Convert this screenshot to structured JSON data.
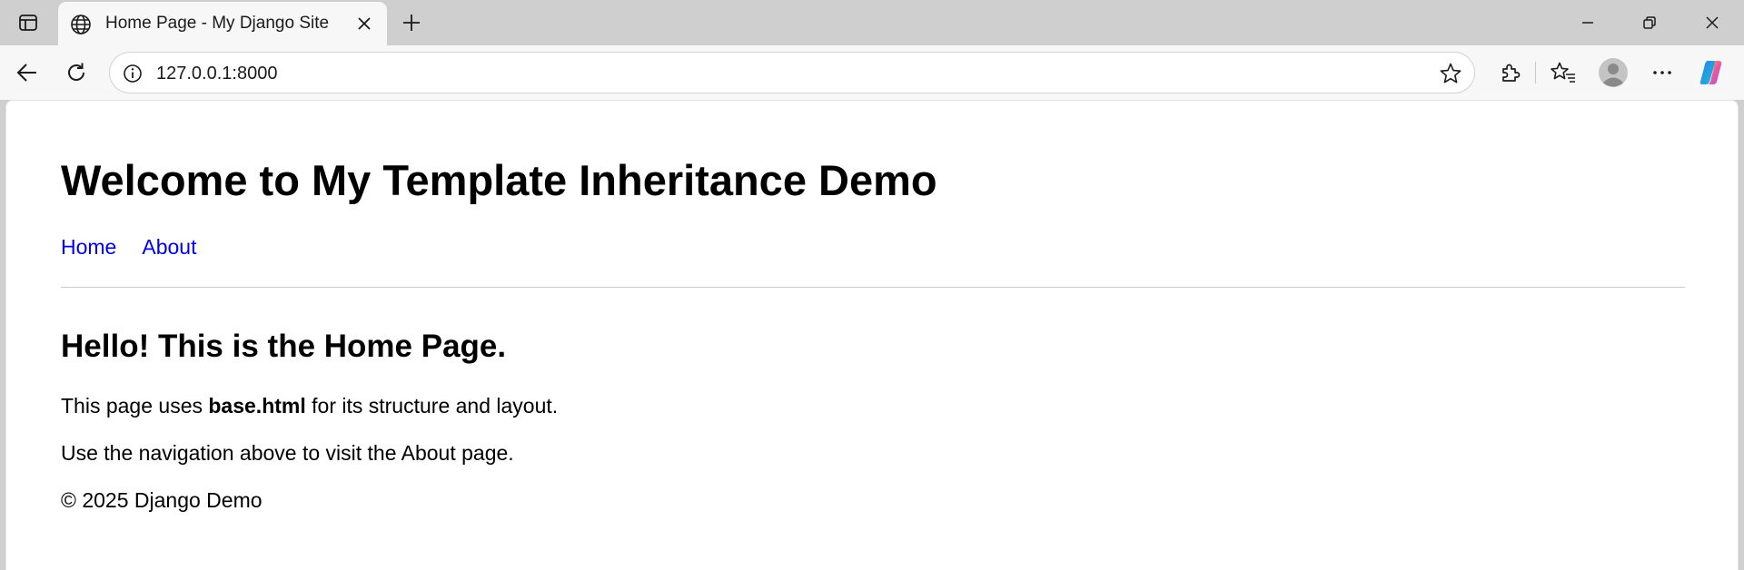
{
  "browser": {
    "tab": {
      "title": "Home Page - My Django Site"
    },
    "address_bar": {
      "url": "127.0.0.1:8000"
    },
    "icons": {
      "tab_actions": "tab-actions-icon",
      "favicon": "globe-icon",
      "tab_close": "close-icon",
      "new_tab": "plus-icon",
      "minimize": "minimize-icon",
      "restore": "restore-icon",
      "window_close": "close-icon",
      "back": "back-arrow-icon",
      "reload": "reload-icon",
      "site_info": "info-icon",
      "favorite": "star-icon",
      "extensions": "puzzle-icon",
      "favorites": "favorites-icon",
      "profile": "avatar-icon",
      "more": "more-icon",
      "copilot": "copilot-icon"
    }
  },
  "page": {
    "site_title": "Welcome to My Template Inheritance Demo",
    "nav": {
      "home": "Home",
      "about": "About"
    },
    "heading": "Hello! This is the Home Page.",
    "paragraph1": {
      "before": "This page uses ",
      "bold": "base.html",
      "after": " for its structure and layout."
    },
    "paragraph2": "Use the navigation above to visit the About page.",
    "footer": "© 2025 Django Demo"
  },
  "colors": {
    "link": "#0000ee",
    "chrome_bg": "#cfcfcf",
    "toolbar_bg": "#f7f7f7",
    "page_bg": "#ffffff",
    "divider": "#cccccc"
  }
}
